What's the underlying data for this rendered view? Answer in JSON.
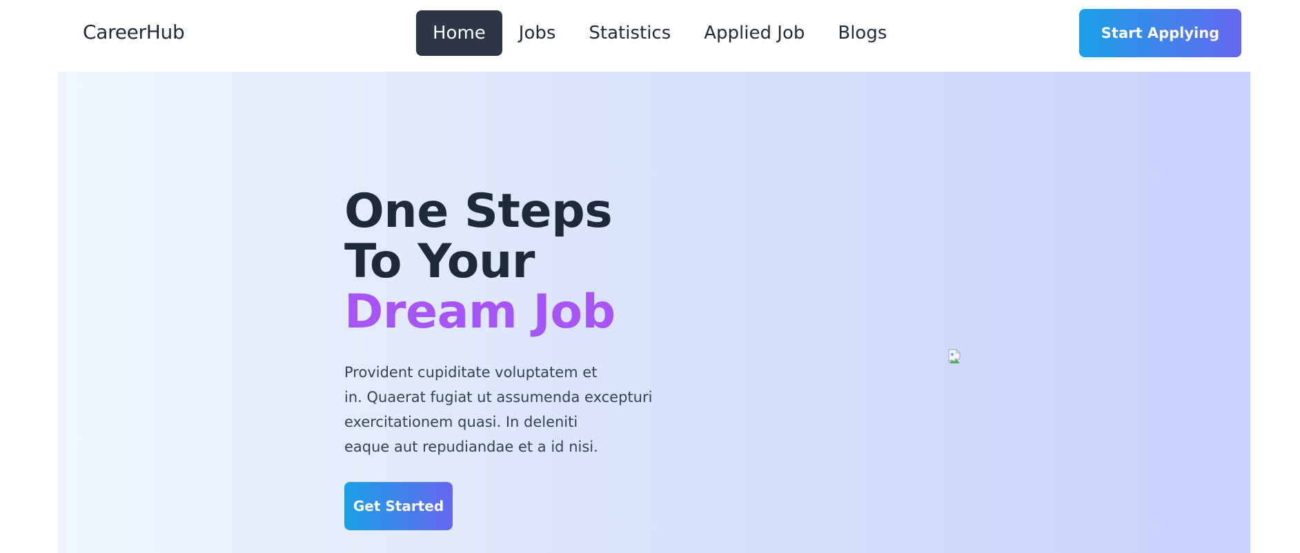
{
  "navbar": {
    "brand": "CareerHub",
    "links": [
      {
        "label": "Home",
        "active": true
      },
      {
        "label": "Jobs",
        "active": false
      },
      {
        "label": "Statistics",
        "active": false
      },
      {
        "label": "Applied Job",
        "active": false
      },
      {
        "label": "Blogs",
        "active": false
      }
    ],
    "cta_label": "Start Applying"
  },
  "hero": {
    "title_line1": "One Steps",
    "title_line2": "To Your",
    "title_accent": "Dream Job",
    "description_lines": [
      "Provident cupiditate voluptatem et",
      "in. Quaerat fugiat ut assumenda excepturi",
      "exercitationem quasi. In deleniti",
      "eaque aut repudiandae et a id nisi."
    ],
    "button_label": "Get Started",
    "image_icon": "broken-image-icon"
  },
  "colors": {
    "accent_purple": "#a855f7",
    "nav_active_bg": "#2d3748",
    "button_gradient_start": "#19a0e8",
    "button_gradient_end": "#6467f0",
    "heading": "#1e293b"
  }
}
